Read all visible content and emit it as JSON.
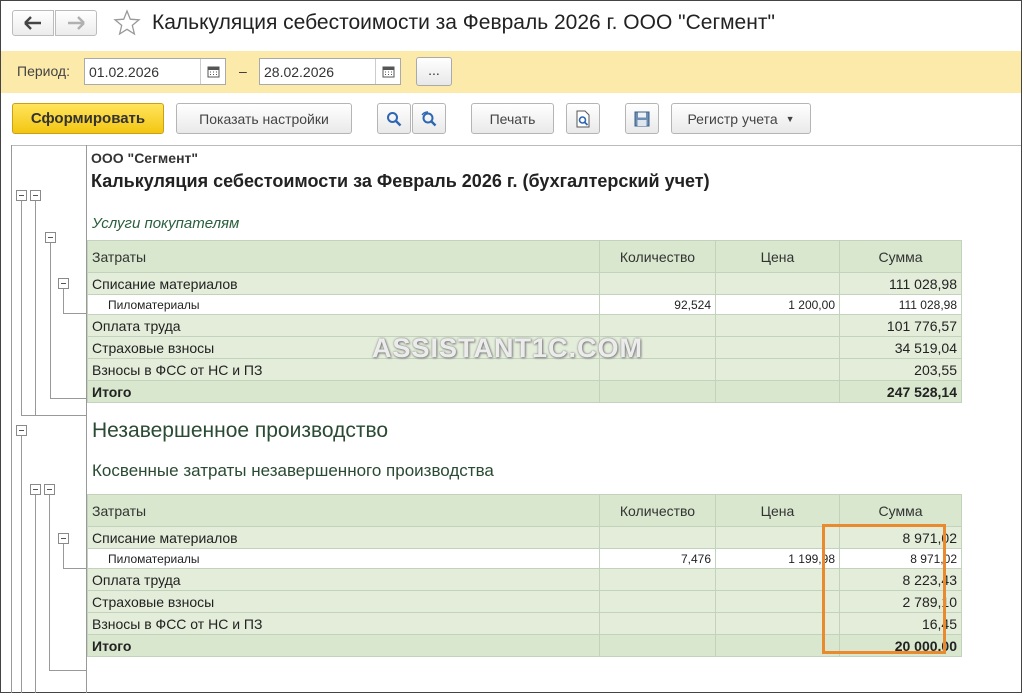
{
  "window": {
    "title": "Калькуляция себестоимости за Февраль 2026 г. ООО \"Сегмент\""
  },
  "period": {
    "label": "Период:",
    "from": "01.02.2026",
    "separator": "–",
    "to": "28.02.2026",
    "more_label": "..."
  },
  "toolbar": {
    "generate": "Сформировать",
    "show_settings": "Показать настройки",
    "print": "Печать",
    "register": "Регистр учета"
  },
  "report": {
    "org": "ООО \"Сегмент\"",
    "title": "Калькуляция себестоимости за Февраль 2026 г. (бухгалтерский учет)",
    "section1": "Услуги покупателям",
    "section2": "Незавершенное производство",
    "section3": "Косвенные затраты незавершенного производства",
    "columns": [
      "Затраты",
      "Количество",
      "Цена",
      "Сумма"
    ],
    "table1": [
      {
        "name": "Списание материалов",
        "qty": "",
        "price": "",
        "sum": "111 028,98",
        "type": "row"
      },
      {
        "name": "Пиломатериалы",
        "qty": "92,524",
        "price": "1 200,00",
        "sum": "111 028,98",
        "type": "sub"
      },
      {
        "name": "Оплата труда",
        "qty": "",
        "price": "",
        "sum": "101 776,57",
        "type": "row"
      },
      {
        "name": "Страховые взносы",
        "qty": "",
        "price": "",
        "sum": "34 519,04",
        "type": "row"
      },
      {
        "name": "Взносы в ФСС от НС и ПЗ",
        "qty": "",
        "price": "",
        "sum": "203,55",
        "type": "row"
      },
      {
        "name": "Итого",
        "qty": "",
        "price": "",
        "sum": "247 528,14",
        "type": "total"
      }
    ],
    "table2": [
      {
        "name": "Списание материалов",
        "qty": "",
        "price": "",
        "sum": "8 971,02",
        "type": "row"
      },
      {
        "name": "Пиломатериалы",
        "qty": "7,476",
        "price": "1 199,98",
        "sum": "8 971,02",
        "type": "sub"
      },
      {
        "name": "Оплата труда",
        "qty": "",
        "price": "",
        "sum": "8 223,43",
        "type": "row"
      },
      {
        "name": "Страховые взносы",
        "qty": "",
        "price": "",
        "sum": "2 789,10",
        "type": "row"
      },
      {
        "name": "Взносы в ФСС от НС и ПЗ",
        "qty": "",
        "price": "",
        "sum": "16,45",
        "type": "row"
      },
      {
        "name": "Итого",
        "qty": "",
        "price": "",
        "sum": "20 000,00",
        "type": "total"
      }
    ]
  },
  "watermark": "ASSISTANT1C.COM",
  "colors": {
    "accent_button": "#f3c612",
    "period_bar": "#fbeaaa",
    "table_fill": "#e3edda",
    "highlight": "#ea8a2e"
  }
}
